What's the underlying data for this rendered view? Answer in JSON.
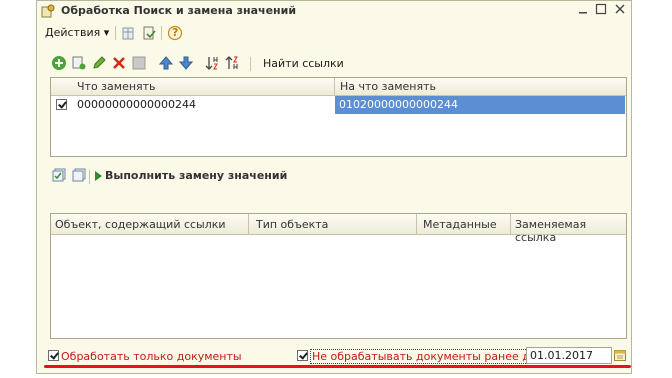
{
  "window": {
    "title": "Обработка  Поиск и замена значений"
  },
  "menubar": {
    "actions_label": "Действия",
    "actions_arrow": "▾",
    "help_symbol": "?"
  },
  "toolbar": {
    "find_links_label": "Найти ссылки"
  },
  "replace_table": {
    "columns": [
      "Что заменять",
      "На что заменять"
    ],
    "rows": [
      {
        "checked": true,
        "what": "00000000000000244",
        "to": "01020000000000244"
      }
    ]
  },
  "actions": {
    "run_label": "Выполнить замену значений"
  },
  "links_table": {
    "columns": [
      "Объект, содержащий ссылки",
      "Тип объекта",
      "Метаданные",
      "Заменяемая ссылка"
    ]
  },
  "bottom": {
    "only_documents_label": "Обработать только документы",
    "skip_before_date_label": "Не обрабатывать документы ранее даты",
    "date_value": "01.01.2017"
  },
  "colors": {
    "highlight": "#5b8fd1",
    "warning_text": "#c41a1a",
    "underline": "#e4141e"
  }
}
